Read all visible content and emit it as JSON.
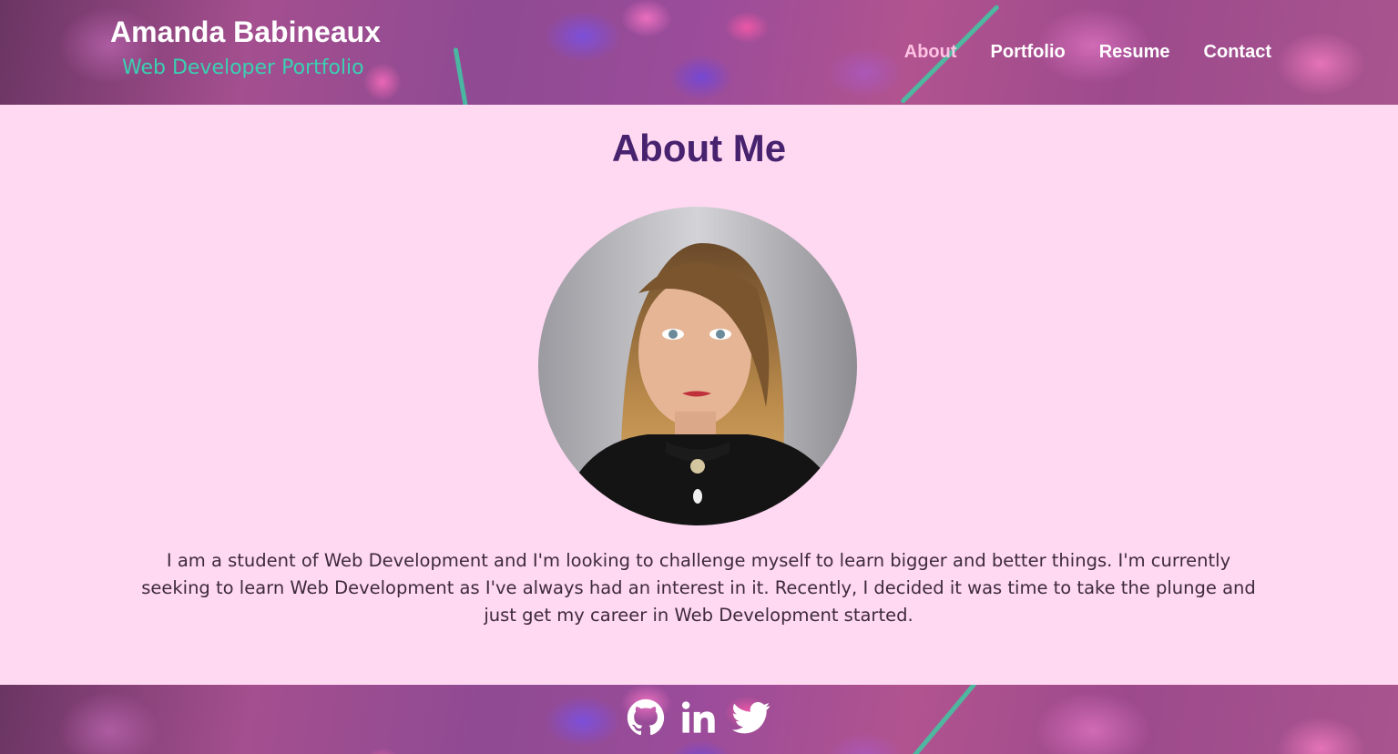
{
  "brand": {
    "name": "Amanda Babineaux",
    "subtitle": "Web Developer Portfolio"
  },
  "nav": {
    "items": [
      {
        "label": "About",
        "active": true
      },
      {
        "label": "Portfolio",
        "active": false
      },
      {
        "label": "Resume",
        "active": false
      },
      {
        "label": "Contact",
        "active": false
      }
    ]
  },
  "main": {
    "title": "About Me",
    "bio": "I am a student of Web Development and I'm looking to challenge myself to learn bigger and better things. I'm currently seeking to learn Web Development as I've always had an interest in it. Recently, I decided it was time to take the plunge and just get my career in Web Development started."
  },
  "footer": {
    "social": [
      "github-icon",
      "linkedin-icon",
      "twitter-icon"
    ]
  },
  "colors": {
    "page_background": "#ffd8f1",
    "title": "#46226f",
    "subtitle": "#3ad1b2",
    "nav_active": "#ffc2e4",
    "nav_text": "#ffffff"
  }
}
